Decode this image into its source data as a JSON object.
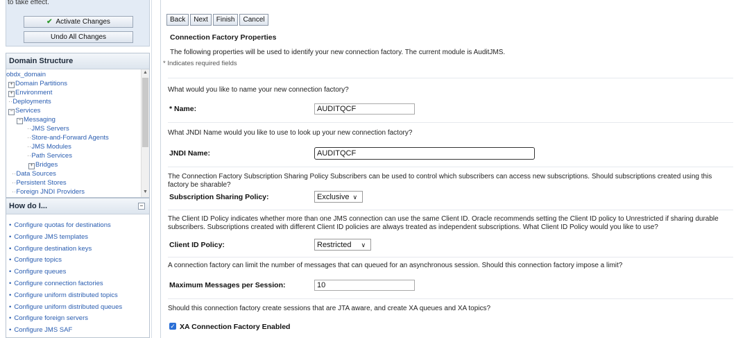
{
  "change_center": {
    "message": "to take effect.",
    "activate_label": "Activate Changes",
    "undo_label": "Undo All Changes"
  },
  "domain_structure": {
    "title": "Domain Structure",
    "items": [
      {
        "label": "obdx_domain",
        "toggle": ""
      },
      {
        "label": "Domain Partitions",
        "toggle": "+"
      },
      {
        "label": "Environment",
        "toggle": "+"
      },
      {
        "label": "Deployments",
        "toggle": ""
      },
      {
        "label": "Services",
        "toggle": "−"
      },
      {
        "label": "Messaging",
        "toggle": "−"
      },
      {
        "label": "JMS Servers",
        "toggle": ""
      },
      {
        "label": "Store-and-Forward Agents",
        "toggle": ""
      },
      {
        "label": "JMS Modules",
        "toggle": ""
      },
      {
        "label": "Path Services",
        "toggle": ""
      },
      {
        "label": "Bridges",
        "toggle": "+"
      },
      {
        "label": "Data Sources",
        "toggle": ""
      },
      {
        "label": "Persistent Stores",
        "toggle": ""
      },
      {
        "label": "Foreign JNDI Providers",
        "toggle": ""
      }
    ]
  },
  "how_do_i": {
    "title": "How do I...",
    "items": [
      "Configure quotas for destinations",
      "Configure JMS templates",
      "Configure destination keys",
      "Configure topics",
      "Configure queues",
      "Configure connection factories",
      "Configure uniform distributed topics",
      "Configure uniform distributed queues",
      "Configure foreign servers",
      "Configure JMS SAF"
    ]
  },
  "wizard": {
    "buttons": {
      "back": "Back",
      "next": "Next",
      "finish": "Finish",
      "cancel": "Cancel"
    },
    "section_title": "Connection Factory Properties",
    "description": "The following properties will be used to identify your new connection factory. The current module is AuditJMS.",
    "required_note": "* Indicates required fields",
    "name_question": "What would you like to name your new connection factory?",
    "name_label": "* Name:",
    "name_value": "AUDITQCF",
    "jndi_question": "What JNDI Name would you like to use to look up your new connection factory?",
    "jndi_label": "JNDI Name:",
    "jndi_value": "AUDITQCF",
    "sharing_question": "The Connection Factory Subscription Sharing Policy Subscribers can be used to control which subscribers can access new subscriptions. Should subscriptions created using this factory be sharable?",
    "sharing_label": "Subscription Sharing Policy:",
    "sharing_value": "Exclusive",
    "client_question": "The Client ID Policy indicates whether more than one JMS connection can use the same Client ID. Oracle recommends setting the Client ID policy to Unrestricted if sharing durable subscribers. Subscriptions created with different Client ID policies are always treated as independent subscriptions. What Client ID Policy would you like to use?",
    "client_label": "Client ID Policy:",
    "client_value": "Restricted",
    "max_question": "A connection factory can limit the number of messages that can queued for an asynchronous session. Should this connection factory impose a limit?",
    "max_label": "Maximum Messages per Session:",
    "max_value": "10",
    "xa_question": "Should this connection factory create sessions that are JTA aware, and create XA queues and XA topics?",
    "xa_label": "XA Connection Factory Enabled"
  },
  "colors": {
    "link": "#2a5db0",
    "panel_header_bg": "#dde5ee",
    "change_center_bg": "#e3ebf5",
    "checkbox": "#2a6fd6"
  }
}
